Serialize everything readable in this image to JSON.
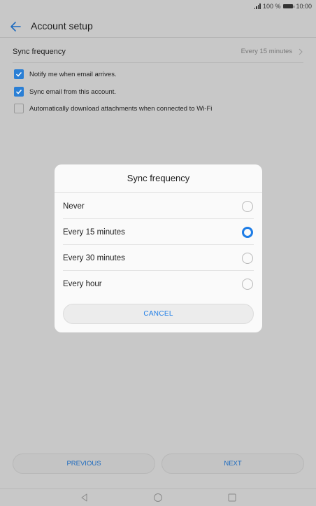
{
  "status_bar": {
    "battery_text": "100 %",
    "time": "10:00"
  },
  "header": {
    "title": "Account setup"
  },
  "sync_row": {
    "label": "Sync frequency",
    "value": "Every 15 minutes"
  },
  "checkboxes": [
    {
      "label": "Notify me when email arrives.",
      "checked": true
    },
    {
      "label": "Sync email from this account.",
      "checked": true
    },
    {
      "label": "Automatically download attachments when connected to Wi-Fi",
      "checked": false
    }
  ],
  "dialog": {
    "title": "Sync frequency",
    "options": [
      {
        "label": "Never",
        "selected": false
      },
      {
        "label": "Every 15 minutes",
        "selected": true
      },
      {
        "label": "Every 30 minutes",
        "selected": false
      },
      {
        "label": "Every hour",
        "selected": false
      }
    ],
    "cancel_label": "CANCEL"
  },
  "footer": {
    "previous_label": "PREVIOUS",
    "next_label": "NEXT"
  },
  "colors": {
    "accent": "#1e7de6",
    "checkbox": "#2a7fd5",
    "scrim": "#c8c8c8"
  }
}
